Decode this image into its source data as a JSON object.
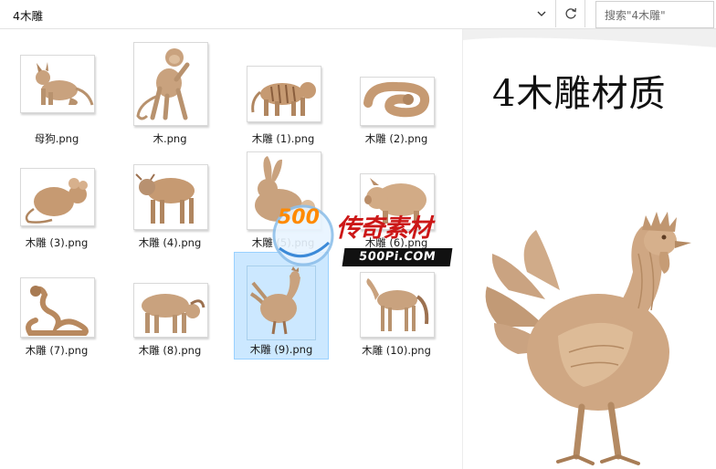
{
  "address_bar": {
    "path": "4木雕"
  },
  "search": {
    "placeholder": "搜索\"4木雕\""
  },
  "files": [
    {
      "name": "母狗.png",
      "icon": "dog-carving-thumbnail"
    },
    {
      "name": "木.png",
      "icon": "monkey-carving-thumbnail"
    },
    {
      "name": "木雕 (1).png",
      "icon": "tiger-carving-thumbnail"
    },
    {
      "name": "木雕 (2).png",
      "icon": "snake-carving-thumbnail"
    },
    {
      "name": "木雕 (3).png",
      "icon": "rat-carving-thumbnail"
    },
    {
      "name": "木雕 (4).png",
      "icon": "ox-carving-thumbnail"
    },
    {
      "name": "木雕 (5).png",
      "icon": "rabbit-carving-thumbnail"
    },
    {
      "name": "木雕 (6).png",
      "icon": "pig-carving-thumbnail"
    },
    {
      "name": "木雕 (7).png",
      "icon": "dragon-carving-thumbnail"
    },
    {
      "name": "木雕 (8).png",
      "icon": "goat-carving-thumbnail"
    },
    {
      "name": "木雕 (9).png",
      "icon": "rooster-carving-thumbnail",
      "selected": true
    },
    {
      "name": "木雕 (10).png",
      "icon": "horse-carving-thumbnail"
    }
  ],
  "preview": {
    "title": "4木雕材质",
    "image": "rooster-carving-preview"
  },
  "watermark": {
    "badge": "500",
    "script": "传奇素材",
    "url": "500Pi.COM"
  },
  "colors": {
    "wood": "#c9a27e",
    "wood_dark": "#9c7150",
    "selection": "#cce8ff",
    "selection_border": "#99d1ff"
  }
}
